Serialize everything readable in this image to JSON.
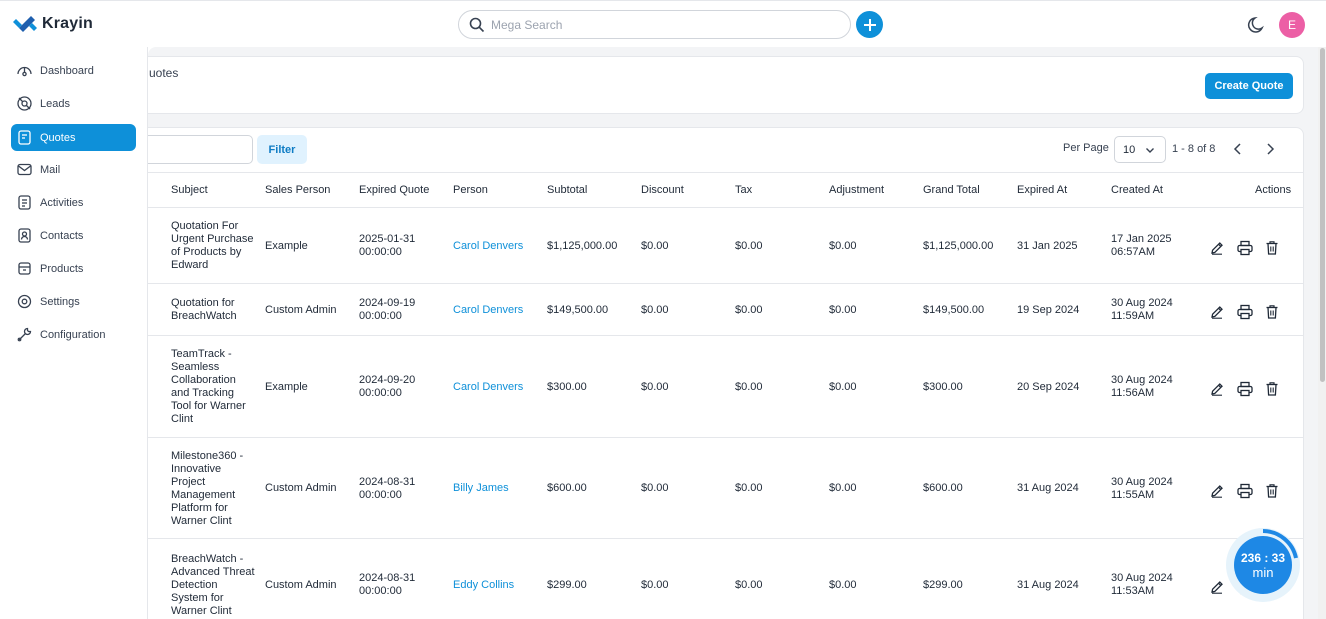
{
  "app": {
    "name": "Krayin"
  },
  "topbar": {
    "search_placeholder": "Mega Search",
    "avatar_initial": "E"
  },
  "sidebar": {
    "items": [
      {
        "label": "Dashboard",
        "icon": "dashboard-icon"
      },
      {
        "label": "Leads",
        "icon": "leads-icon"
      },
      {
        "label": "Quotes",
        "icon": "quotes-icon",
        "active": true
      },
      {
        "label": "Mail",
        "icon": "mail-icon"
      },
      {
        "label": "Activities",
        "icon": "activities-icon"
      },
      {
        "label": "Contacts",
        "icon": "contacts-icon"
      },
      {
        "label": "Products",
        "icon": "products-icon"
      },
      {
        "label": "Settings",
        "icon": "settings-icon"
      },
      {
        "label": "Configuration",
        "icon": "configuration-icon"
      }
    ]
  },
  "page": {
    "breadcrumb": "uotes",
    "create_button": "Create Quote"
  },
  "toolbar": {
    "filter_label": "Filter",
    "per_page_label": "Per Page",
    "per_page_value": "10",
    "pagination_info": "1 - 8 of 8"
  },
  "table": {
    "columns": [
      "Subject",
      "Sales Person",
      "Expired Quote",
      "Person",
      "Subtotal",
      "Discount",
      "Tax",
      "Adjustment",
      "Grand Total",
      "Expired At",
      "Created At",
      "Actions"
    ],
    "rows": [
      {
        "subject": [
          "Quotation For",
          "Urgent Purchase",
          "of Products by",
          "Edward"
        ],
        "sales_person": "Example",
        "expired_quote": [
          "2025-01-31",
          "00:00:00"
        ],
        "person": "Carol Denvers",
        "subtotal": "$1,125,000.00",
        "discount": "$0.00",
        "tax": "$0.00",
        "adjustment": "$0.00",
        "grand_total": "$1,125,000.00",
        "expired_at": "31 Jan 2025",
        "created_at": [
          "17 Jan 2025",
          "06:57AM"
        ]
      },
      {
        "subject": [
          "Quotation for",
          "BreachWatch"
        ],
        "sales_person": "Custom Admin",
        "expired_quote": [
          "2024-09-19",
          "00:00:00"
        ],
        "person": "Carol Denvers",
        "subtotal": "$149,500.00",
        "discount": "$0.00",
        "tax": "$0.00",
        "adjustment": "$0.00",
        "grand_total": "$149,500.00",
        "expired_at": "19 Sep 2024",
        "created_at": [
          "30 Aug 2024",
          "11:59AM"
        ]
      },
      {
        "subject": [
          "TeamTrack -",
          "Seamless",
          "Collaboration",
          "and Tracking",
          "Tool for Warner",
          "Clint"
        ],
        "sales_person": "Example",
        "expired_quote": [
          "2024-09-20",
          "00:00:00"
        ],
        "person": "Carol Denvers",
        "subtotal": "$300.00",
        "discount": "$0.00",
        "tax": "$0.00",
        "adjustment": "$0.00",
        "grand_total": "$300.00",
        "expired_at": "20 Sep 2024",
        "created_at": [
          "30 Aug 2024",
          "11:56AM"
        ]
      },
      {
        "subject": [
          "Milestone360 -",
          "Innovative",
          "Project",
          "Management",
          "Platform for",
          "Warner Clint"
        ],
        "sales_person": "Custom Admin",
        "expired_quote": [
          "2024-08-31",
          "00:00:00"
        ],
        "person": "Billy James",
        "subtotal": "$600.00",
        "discount": "$0.00",
        "tax": "$0.00",
        "adjustment": "$0.00",
        "grand_total": "$600.00",
        "expired_at": "31 Aug 2024",
        "created_at": [
          "30 Aug 2024",
          "11:55AM"
        ]
      },
      {
        "subject": [
          "BreachWatch -",
          "Advanced Threat",
          "Detection",
          "System for",
          "Warner Clint"
        ],
        "sales_person": "Custom Admin",
        "expired_quote": [
          "2024-08-31",
          "00:00:00"
        ],
        "person": "Eddy Collins",
        "subtotal": "$299.00",
        "discount": "$0.00",
        "tax": "$0.00",
        "adjustment": "$0.00",
        "grand_total": "$299.00",
        "expired_at": "31 Aug 2024",
        "created_at": [
          "30 Aug 2024",
          "11:53AM"
        ]
      }
    ]
  },
  "timer": {
    "time": "236 : 33",
    "unit": "min"
  },
  "colors": {
    "accent": "#0e90d9",
    "avatar": "#ec5fa5",
    "link": "#0e90d9"
  }
}
